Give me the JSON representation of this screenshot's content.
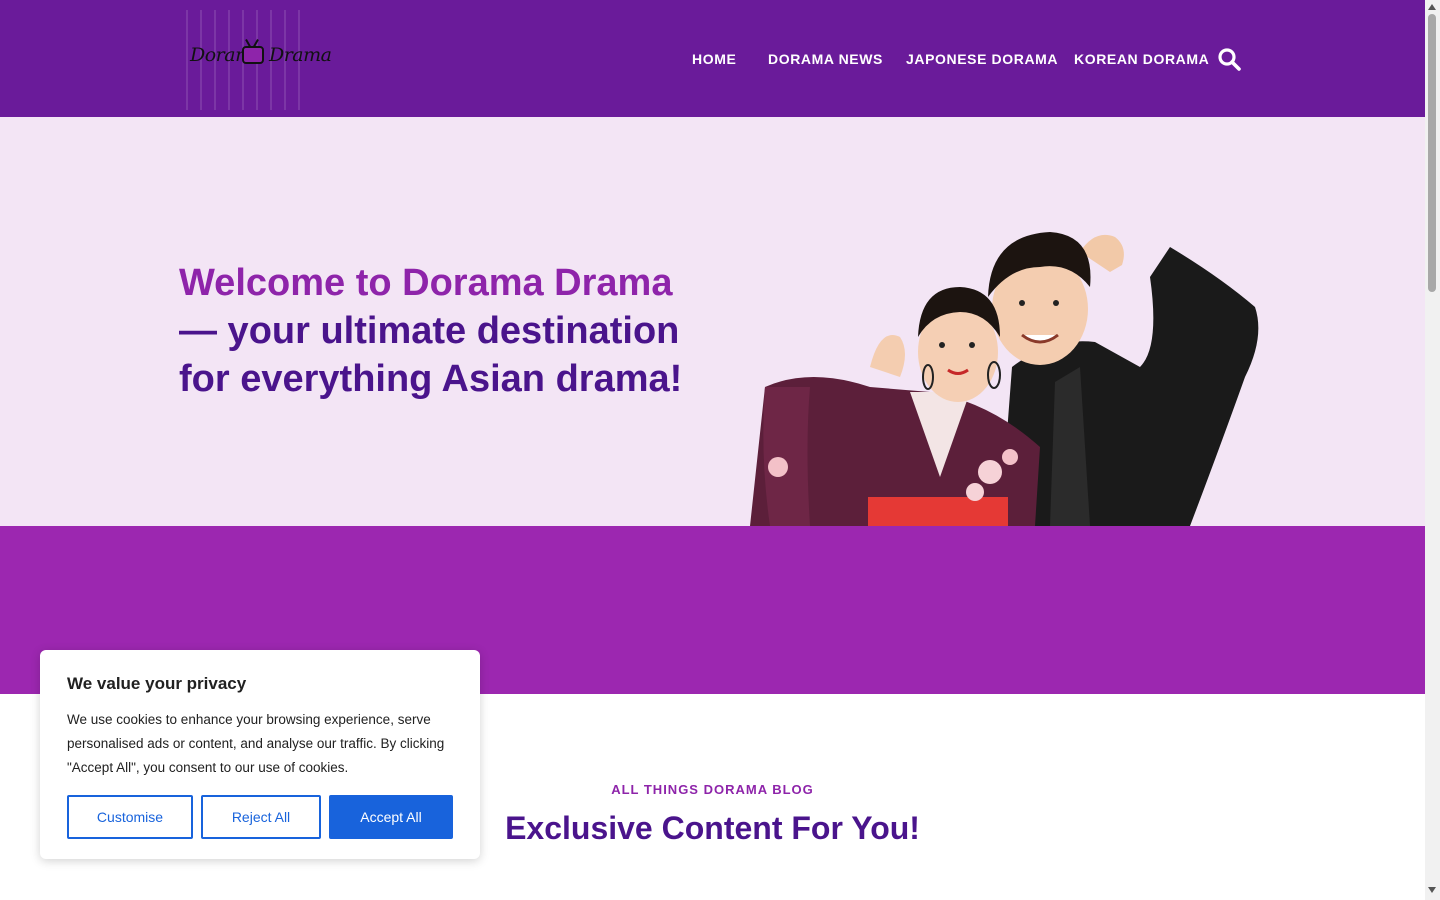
{
  "header": {
    "logo_text": "Dorama Drama",
    "nav": [
      "HOME",
      "DORAMA NEWS",
      "JAPONESE DORAMA",
      "KOREAN DORAMA"
    ],
    "search_icon": "search-icon"
  },
  "hero": {
    "headline_strong": "Welcome to Dorama Drama",
    "headline_rest": " — your ultimate destination for everything Asian drama!"
  },
  "blog": {
    "kicker": "ALL THINGS DORAMA BLOG",
    "title": "Exclusive Content For You!"
  },
  "cookie_banner": {
    "title": "We value your privacy",
    "body": "We use cookies to enhance your browsing experience, serve personalised ads or content, and analyse our traffic. By clicking \"Accept All\", you consent to our use of cookies.",
    "customise_label": "Customise",
    "reject_label": "Reject All",
    "accept_label": "Accept All"
  },
  "colors": {
    "header_bg": "#6a1b9a",
    "hero_bg": "#f3e5f5",
    "band_bg": "#9c27b0",
    "accent": "#8e24aa",
    "heading": "#4a148c",
    "button_blue": "#1863dc"
  }
}
